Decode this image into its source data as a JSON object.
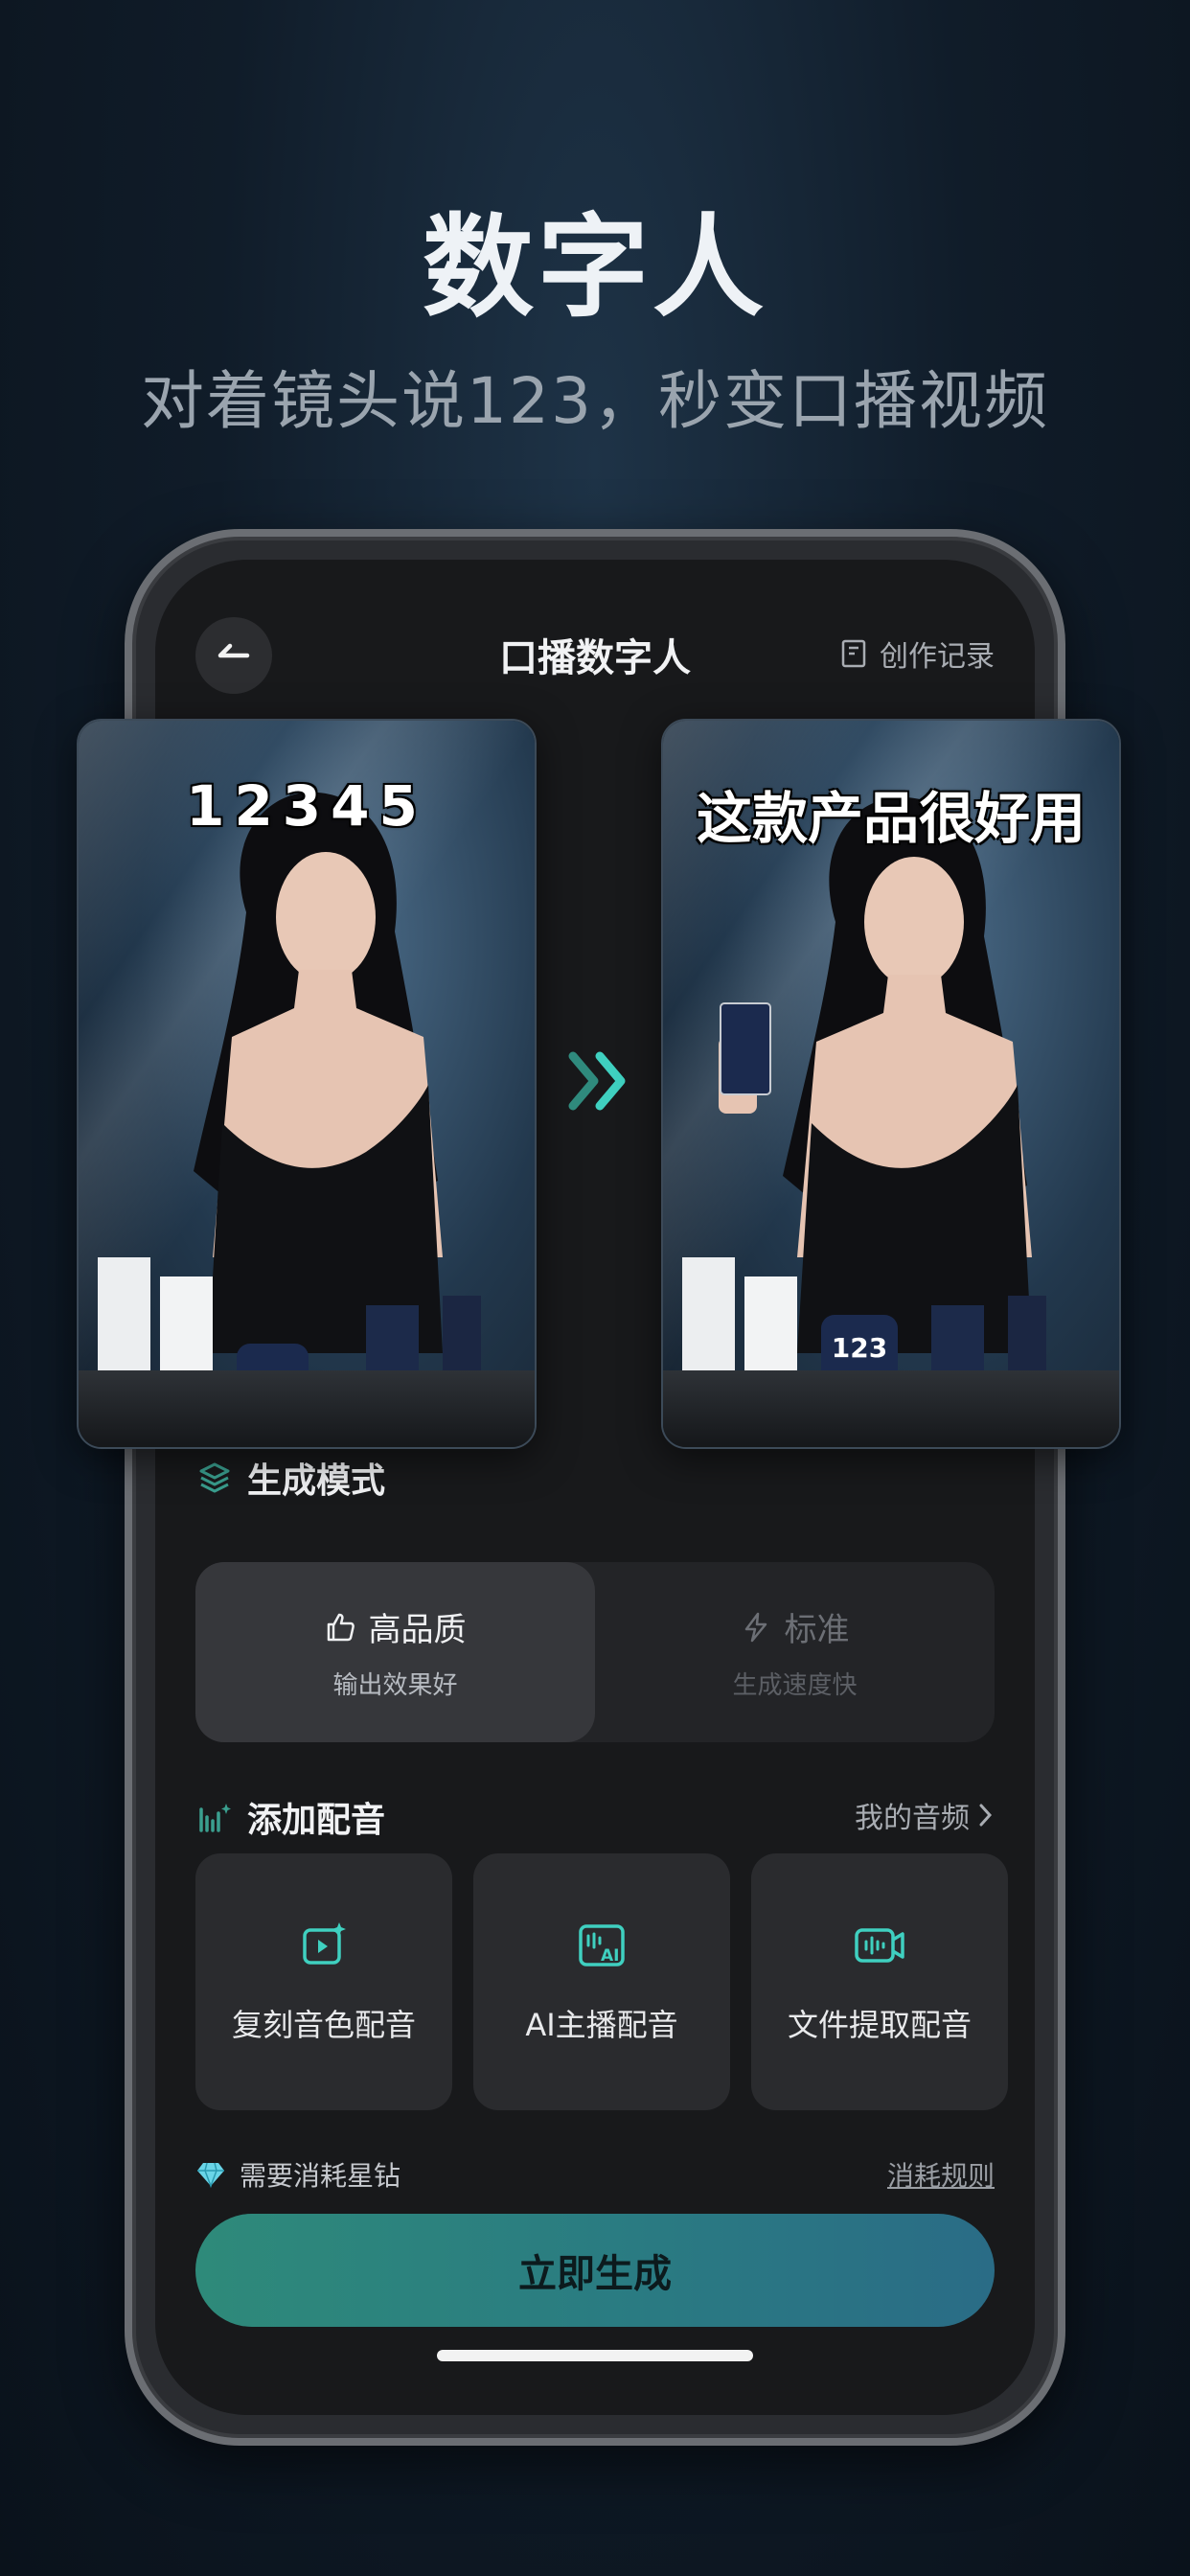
{
  "hero": {
    "title": "数字人",
    "subtitle": "对着镜头说123，秒变口播视频"
  },
  "navbar": {
    "title": "口播数字人",
    "record_label": "创作记录"
  },
  "preview": {
    "before_caption": "12345",
    "after_caption": "这款产品很好用",
    "device_text": "123"
  },
  "mode": {
    "section_title": "生成模式",
    "options": [
      {
        "label": "高品质",
        "desc": "输出效果好",
        "selected": true
      },
      {
        "label": "标准",
        "desc": "生成速度快",
        "selected": false
      }
    ]
  },
  "dubbing": {
    "section_title": "添加配音",
    "my_audio_label": "我的音频",
    "options": [
      {
        "label": "复刻音色配音",
        "icon": "clone-voice-icon"
      },
      {
        "label": "AI主播配音",
        "icon": "ai-anchor-icon"
      },
      {
        "label": "文件提取配音",
        "icon": "file-extract-icon"
      }
    ]
  },
  "cost": {
    "note": "需要消耗星钻",
    "rule_link": "消耗规则"
  },
  "generate_button": "立即生成",
  "colors": {
    "accent_teal": "#3fd0c0",
    "button_gradient_start": "#2e8a7a",
    "button_gradient_end": "#2a6c86"
  }
}
